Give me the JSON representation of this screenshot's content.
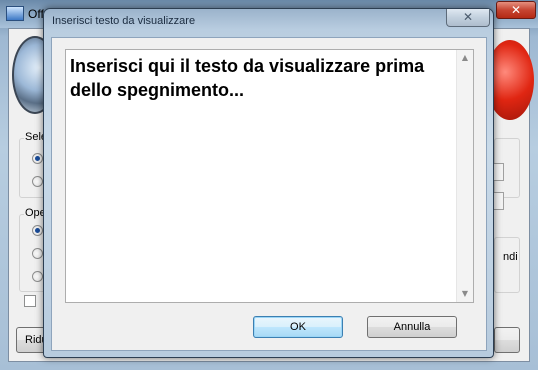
{
  "background_window": {
    "title": "Off",
    "groups": [
      {
        "label": "Sele"
      },
      {
        "label": "Ope"
      }
    ],
    "bottom_button_label": "Ridu",
    "right_partial_text": "ndi",
    "close_glyph": "✕"
  },
  "dialog": {
    "title": "Inserisci testo da visualizzare",
    "close_glyph": "✕",
    "text_content": "Inserisci qui il testo da visualizzare prima dello spegnimento...",
    "scroll_up_glyph": "▲",
    "scroll_down_glyph": "▼",
    "ok_label": "OK",
    "cancel_label": "Annulla"
  },
  "colors": {
    "dialog_frame": "#b9cde0",
    "default_button": "#a7d9f5",
    "close_red": "#c74532"
  }
}
